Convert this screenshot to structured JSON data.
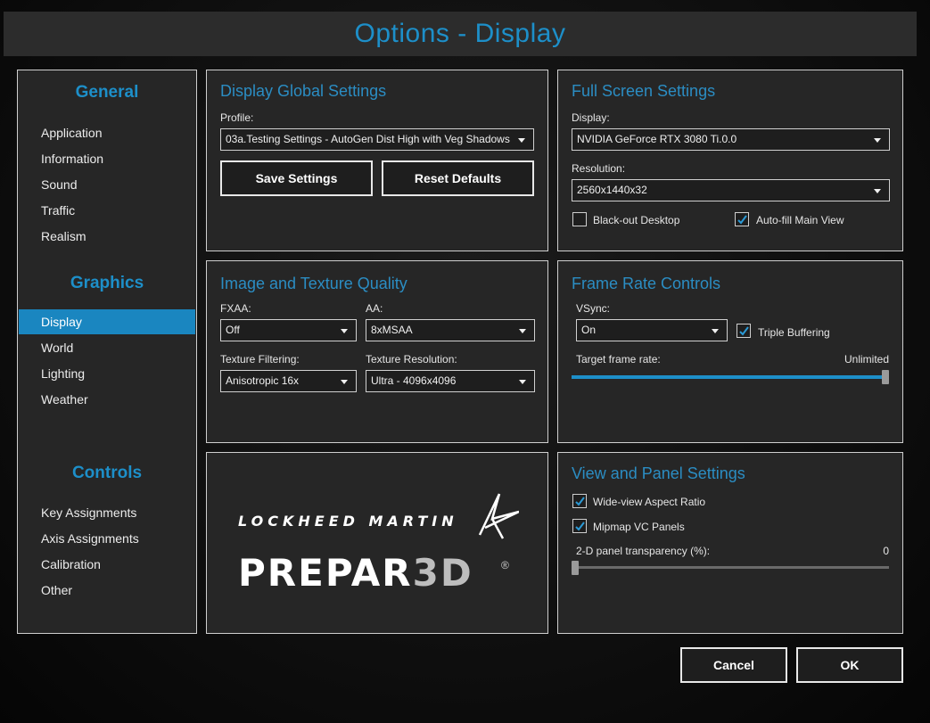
{
  "window": {
    "title": "Options - Display"
  },
  "sidebar": {
    "sections": [
      {
        "title": "General",
        "items": [
          "Application",
          "Information",
          "Sound",
          "Traffic",
          "Realism"
        ]
      },
      {
        "title": "Graphics",
        "items": [
          "Display",
          "World",
          "Lighting",
          "Weather"
        ]
      },
      {
        "title": "Controls",
        "items": [
          "Key Assignments",
          "Axis Assignments",
          "Calibration",
          "Other"
        ]
      }
    ],
    "active_item": "Display"
  },
  "display_global": {
    "title": "Display Global Settings",
    "profile_label": "Profile:",
    "profile_value": "03a.Testing Settings - AutoGen Dist High with Veg Shadows",
    "save_label": "Save Settings",
    "reset_label": "Reset Defaults"
  },
  "full_screen": {
    "title": "Full Screen Settings",
    "display_label": "Display:",
    "display_value": "NVIDIA GeForce RTX 3080 Ti.0.0",
    "resolution_label": "Resolution:",
    "resolution_value": "2560x1440x32",
    "blackout_label": "Black-out Desktop",
    "blackout_checked": false,
    "autofill_label": "Auto-fill Main View",
    "autofill_checked": true
  },
  "image_quality": {
    "title": "Image and Texture Quality",
    "fxaa_label": "FXAA:",
    "fxaa_value": "Off",
    "aa_label": "AA:",
    "aa_value": "8xMSAA",
    "filtering_label": "Texture Filtering:",
    "filtering_value": "Anisotropic 16x",
    "texres_label": "Texture Resolution:",
    "texres_value": "Ultra - 4096x4096"
  },
  "frame_rate": {
    "title": "Frame Rate Controls",
    "vsync_label": "VSync:",
    "vsync_value": "On",
    "triple_label": "Triple Buffering",
    "triple_checked": true,
    "target_label": "Target frame rate:",
    "target_value": "Unlimited",
    "target_slider_fraction": 1.0
  },
  "view_panel": {
    "title": "View and Panel Settings",
    "wideview_label": "Wide-view Aspect Ratio",
    "wideview_checked": true,
    "mipmap_label": "Mipmap VC Panels",
    "mipmap_checked": true,
    "transparency_label": "2-D panel transparency (%):",
    "transparency_value": "0",
    "transparency_fraction": 0.0
  },
  "branding": {
    "lm_text": "LOCKHEED MARTIN",
    "product_prefix": "PREPAR",
    "product_suffix": "3D",
    "reg_mark": "®"
  },
  "footer": {
    "cancel_label": "Cancel",
    "ok_label": "OK"
  },
  "colors": {
    "accent": "#1d8fc9",
    "panel_bg": "#262626",
    "border": "#cfcfcf"
  },
  "icons": {
    "dropdown": "chevron-down-icon",
    "check": "checkmark-icon"
  }
}
